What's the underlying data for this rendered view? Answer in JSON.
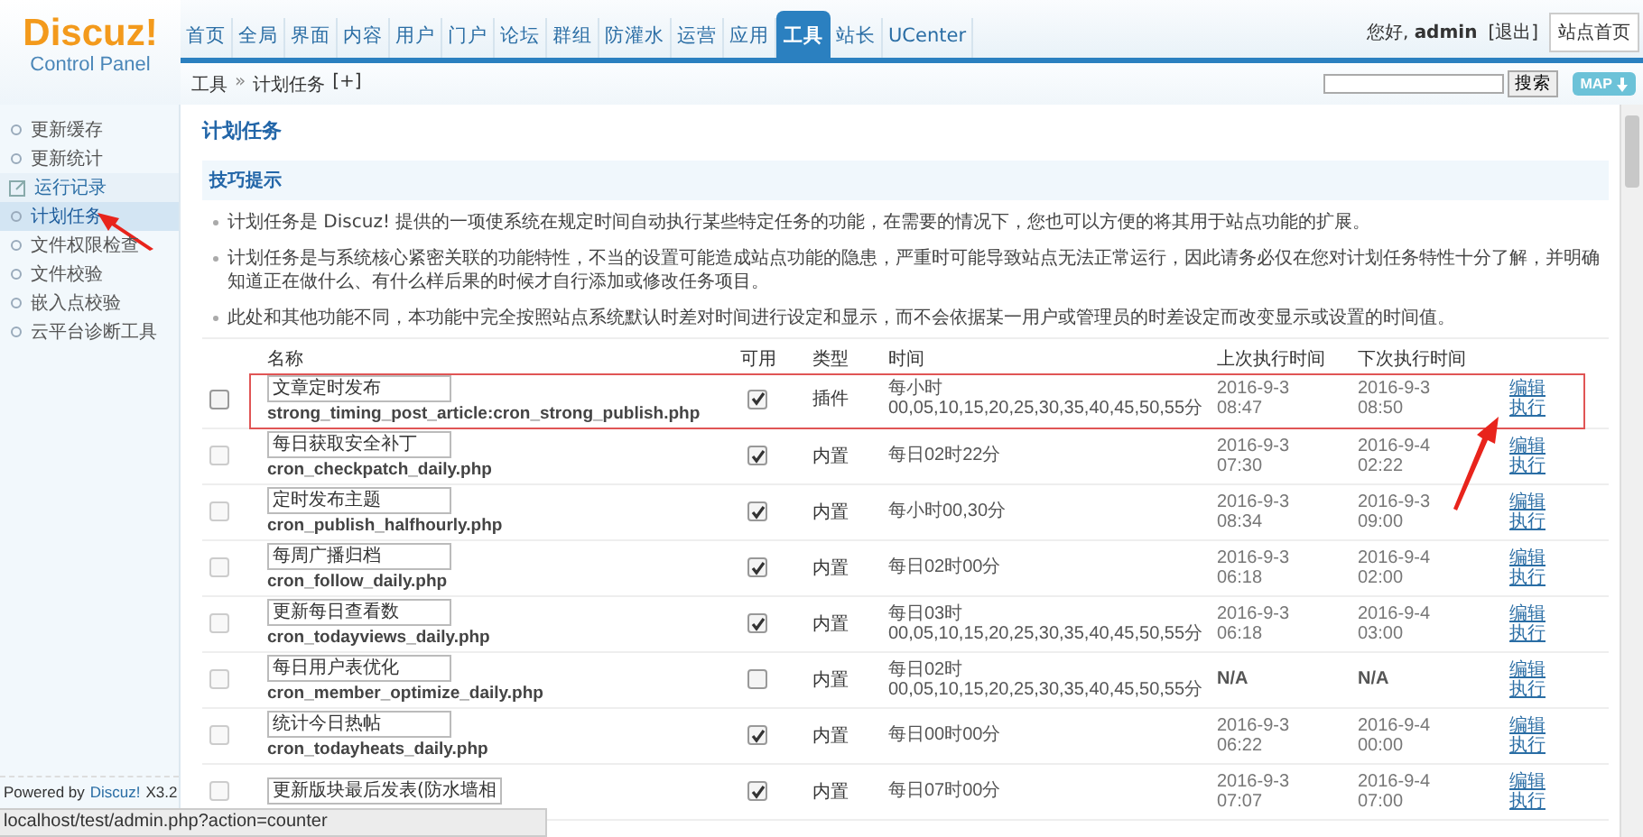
{
  "logo": {
    "title": "Discuz!",
    "subtitle": "Control Panel"
  },
  "nav": [
    {
      "label": "首页",
      "selected": false
    },
    {
      "label": "全局",
      "selected": false
    },
    {
      "label": "界面",
      "selected": false
    },
    {
      "label": "内容",
      "selected": false
    },
    {
      "label": "用户",
      "selected": false
    },
    {
      "label": "门户",
      "selected": false
    },
    {
      "label": "论坛",
      "selected": false
    },
    {
      "label": "群组",
      "selected": false
    },
    {
      "label": "防灌水",
      "selected": false
    },
    {
      "label": "运营",
      "selected": false
    },
    {
      "label": "应用",
      "selected": false
    },
    {
      "label": "工具",
      "selected": true
    },
    {
      "label": "站长",
      "selected": false
    },
    {
      "label": "UCenter",
      "selected": false
    }
  ],
  "user": {
    "greeting": "您好,",
    "name": "admin",
    "logout": "[退出]",
    "home_button": "站点首页"
  },
  "breadcrumb": {
    "section": "工具",
    "separator": "»",
    "page": "计划任务",
    "add": "[+]"
  },
  "search": {
    "button": "搜索",
    "map_button": "MAP"
  },
  "sidebar": {
    "items": [
      {
        "label": "更新缓存",
        "selected": false,
        "external": false,
        "arrow": false
      },
      {
        "label": "更新统计",
        "selected": false,
        "external": false,
        "arrow": false
      },
      {
        "label": "运行记录",
        "selected": false,
        "external": true,
        "arrow": false
      },
      {
        "label": "计划任务",
        "selected": true,
        "external": false,
        "arrow": true
      },
      {
        "label": "文件权限检查",
        "selected": false,
        "external": false,
        "arrow": false
      },
      {
        "label": "文件校验",
        "selected": false,
        "external": false,
        "arrow": false
      },
      {
        "label": "嵌入点校验",
        "selected": false,
        "external": false,
        "arrow": false
      },
      {
        "label": "云平台诊断工具",
        "selected": false,
        "external": false,
        "arrow": false
      }
    ],
    "footer": [
      {
        "text": "Powered by",
        "kind": "text"
      },
      {
        "text": "Discuz!",
        "kind": "link"
      },
      {
        "text": "X3.2",
        "kind": "text"
      }
    ]
  },
  "page_title": "计划任务",
  "tips": {
    "title": "技巧提示",
    "items": [
      "计划任务是 Discuz! 提供的一项使系统在规定时间自动执行某些特定任务的功能，在需要的情况下，您也可以方便的将其用于站点功能的扩展。",
      "计划任务是与系统核心紧密关联的功能特性，不当的设置可能造成站点功能的隐患，严重时可能导致站点无法正常运行，因此请务必仅在您对计划任务特性十分了解，并明确知道正在做什么、有什么样后果的时候才自行添加或修改任务项目。",
      "此处和其他功能不同，本功能中完全按照站点系统默认时差对时间进行设定和显示，而不会依据某一用户或管理员的时差设定而改变显示或设置的时间值。"
    ]
  },
  "table": {
    "highlight_arrow": true,
    "columns": [
      "名称",
      "可用",
      "类型",
      "时间",
      "上次执行时间",
      "下次执行时间"
    ],
    "rows": [
      {
        "name": "文章定时发布",
        "file": "strong_timing_post_article:cron_strong_publish.php",
        "disabled": false,
        "available": true,
        "type": "插件",
        "time": [
          "每小时",
          "00,05,10,15,20,25,30,35,40,45,50,55分"
        ],
        "last_run": [
          "2016-9-3",
          "08:47"
        ],
        "next_run": [
          "2016-9-3",
          "08:50"
        ],
        "actions": [
          "编辑",
          "执行"
        ],
        "highlighted": true
      },
      {
        "name": "每日获取安全补丁",
        "file": "cron_checkpatch_daily.php",
        "disabled": true,
        "available": true,
        "type": "内置",
        "time": [
          "每日02时22分"
        ],
        "last_run": [
          "2016-9-3",
          "07:30"
        ],
        "next_run": [
          "2016-9-4",
          "02:22"
        ],
        "actions": [
          "编辑",
          "执行"
        ],
        "highlighted": false
      },
      {
        "name": "定时发布主题",
        "file": "cron_publish_halfhourly.php",
        "disabled": true,
        "available": true,
        "type": "内置",
        "time": [
          "每小时00,30分"
        ],
        "last_run": [
          "2016-9-3",
          "08:34"
        ],
        "next_run": [
          "2016-9-3",
          "09:00"
        ],
        "actions": [
          "编辑",
          "执行"
        ],
        "highlighted": false
      },
      {
        "name": "每周广播归档",
        "file": "cron_follow_daily.php",
        "disabled": true,
        "available": true,
        "type": "内置",
        "time": [
          "每日02时00分"
        ],
        "last_run": [
          "2016-9-3",
          "06:18"
        ],
        "next_run": [
          "2016-9-4",
          "02:00"
        ],
        "actions": [
          "编辑",
          "执行"
        ],
        "highlighted": false
      },
      {
        "name": "更新每日查看数",
        "file": "cron_todayviews_daily.php",
        "disabled": true,
        "available": true,
        "type": "内置",
        "time": [
          "每日03时",
          "00,05,10,15,20,25,30,35,40,45,50,55分"
        ],
        "last_run": [
          "2016-9-3",
          "06:18"
        ],
        "next_run": [
          "2016-9-4",
          "03:00"
        ],
        "actions": [
          "编辑",
          "执行"
        ],
        "highlighted": false
      },
      {
        "name": "每日用户表优化",
        "file": "cron_member_optimize_daily.php",
        "disabled": true,
        "available": false,
        "type": "内置",
        "time": [
          "每日02时",
          "00,05,10,15,20,25,30,35,40,45,50,55分"
        ],
        "last_run": [
          "N/A"
        ],
        "next_run": [
          "N/A"
        ],
        "actions": [
          "编辑",
          "执行"
        ],
        "highlighted": false
      },
      {
        "name": "统计今日热帖",
        "file": "cron_todayheats_daily.php",
        "disabled": true,
        "available": true,
        "type": "内置",
        "time": [
          "每日00时00分"
        ],
        "last_run": [
          "2016-9-3",
          "06:22"
        ],
        "next_run": [
          "2016-9-4",
          "00:00"
        ],
        "actions": [
          "编辑",
          "执行"
        ],
        "highlighted": false
      },
      {
        "name": "更新版块最后发表(防水墙相",
        "disabled": true,
        "available": true,
        "type": "内置",
        "time": [
          "每日07时00分"
        ],
        "last_run": [
          "2016-9-3",
          "07:07"
        ],
        "next_run": [
          "2016-9-4",
          "07:00"
        ],
        "actions": [
          "编辑",
          "执行"
        ],
        "highlighted": false
      }
    ]
  },
  "status_bar": "localhost/test/admin.php?action=counter"
}
